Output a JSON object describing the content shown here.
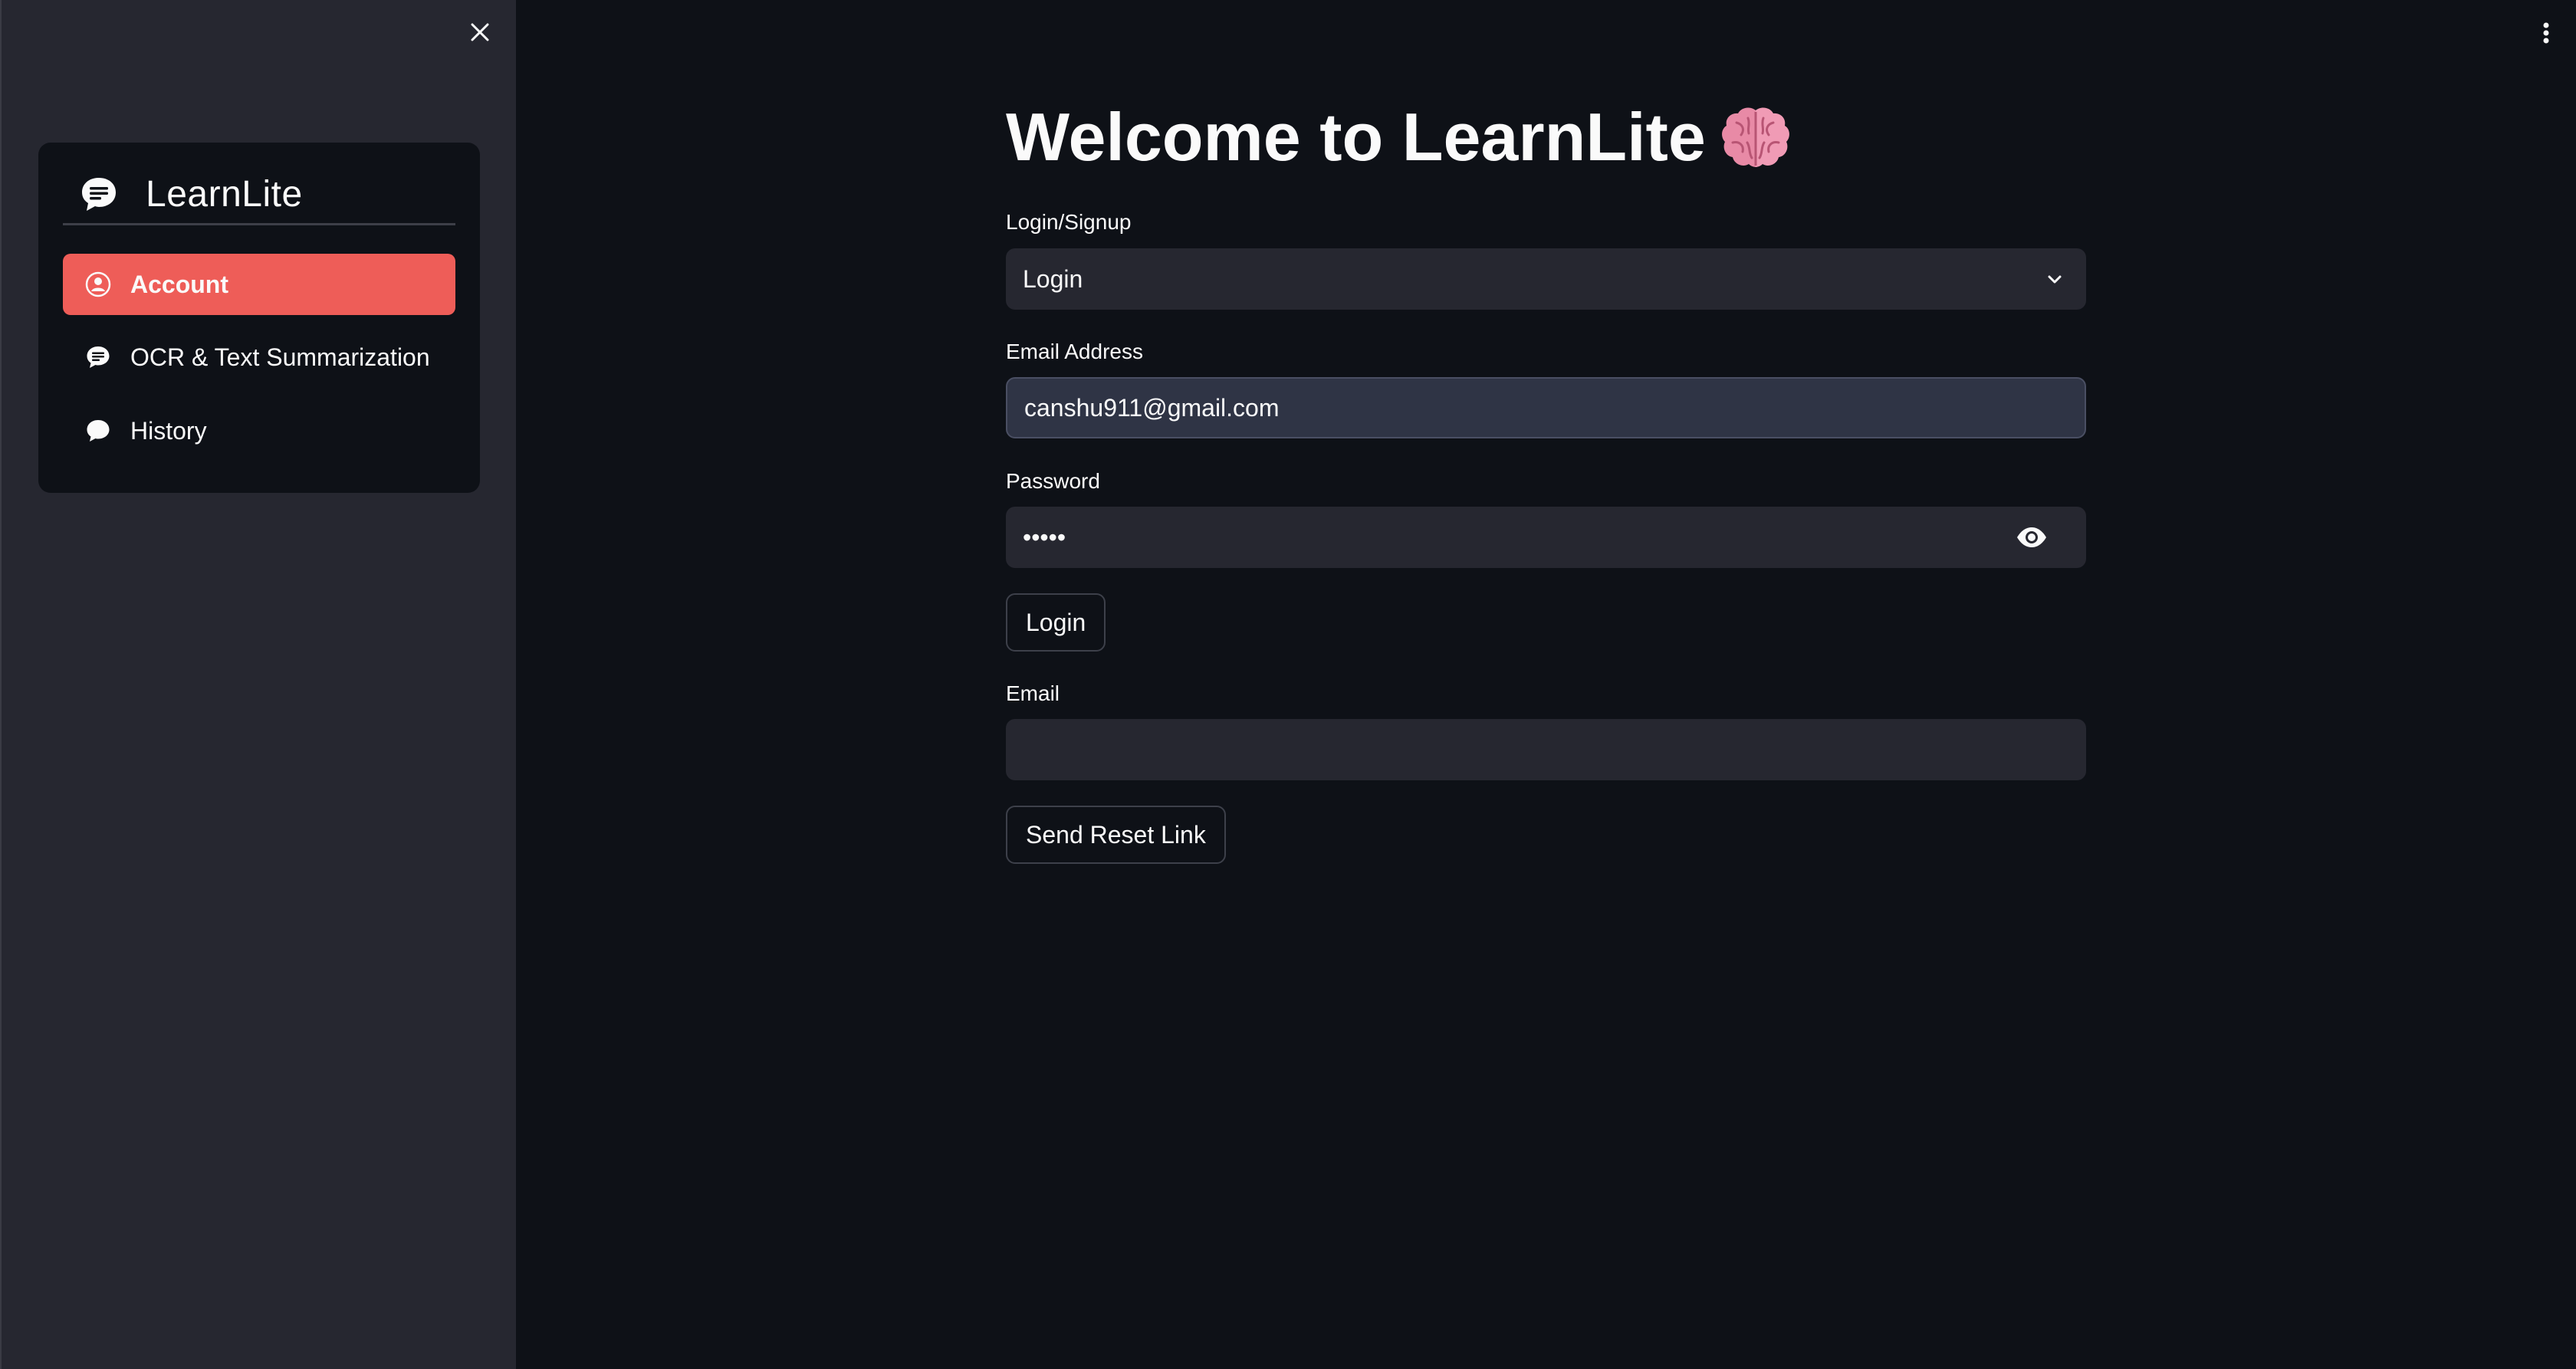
{
  "sidebar": {
    "app_name": "LearnLite",
    "items": [
      {
        "label": "Account",
        "icon": "person-circle-icon",
        "active": true
      },
      {
        "label": "OCR & Text Summarization",
        "icon": "chat-text-icon",
        "active": false
      },
      {
        "label": "History",
        "icon": "chat-bubble-icon",
        "active": false
      }
    ]
  },
  "main": {
    "title": "Welcome to LearnLite",
    "title_icon": "brain-icon",
    "mode_select": {
      "label": "Login/Signup",
      "value": "Login"
    },
    "email": {
      "label": "Email Address",
      "value": "canshu911@gmail.com"
    },
    "password": {
      "label": "Password",
      "value": "•••••"
    },
    "login_button": "Login",
    "reset_email": {
      "label": "Email",
      "value": ""
    },
    "reset_button": "Send Reset Link"
  },
  "colors": {
    "background": "#0e1117",
    "sidebar": "#262730",
    "accent": "#ee5d58",
    "input_bg": "#262730"
  }
}
